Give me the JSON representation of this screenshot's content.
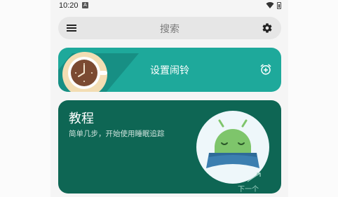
{
  "status_bar": {
    "time": "10:20",
    "notification_glyph": "A"
  },
  "search": {
    "placeholder": "搜索"
  },
  "alarm_card": {
    "title": "设置闹铃"
  },
  "tutorial_card": {
    "title": "教程",
    "subtitle": "简单几步，开始使用睡眠追踪",
    "next_label": "下一个"
  },
  "colors": {
    "alarm_card": "#1ea99b",
    "tutorial_card": "#0e6654",
    "search_bar": "#e6e6e6"
  },
  "icons": {
    "menu": "menu-icon",
    "settings": "gear-icon",
    "alarm_add": "alarm-add-icon",
    "coffee": "coffee-cup-icon",
    "android_sleep": "sleeping-android-icon",
    "next": "arrow-icon"
  }
}
